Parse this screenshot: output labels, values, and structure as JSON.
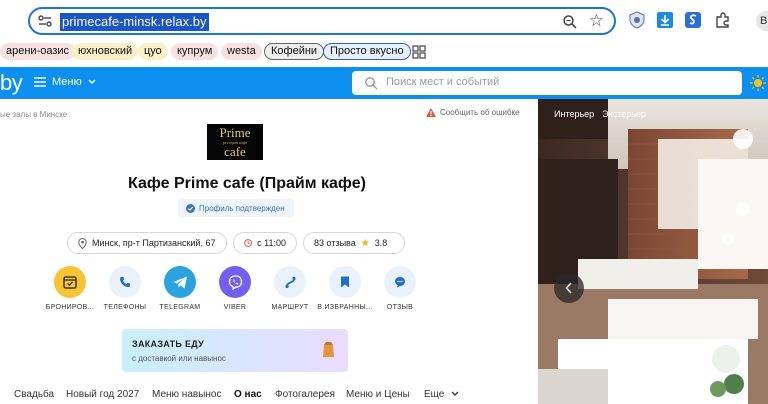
{
  "browser": {
    "url": "primecafe-minsk.relax.by",
    "avatar_letter": "B"
  },
  "bookmarks": [
    {
      "label": "арени-оазис",
      "style": "pink"
    },
    {
      "label": "юхновский",
      "style": "yellow"
    },
    {
      "label": "цуо",
      "style": "yellow"
    },
    {
      "label": "купрум",
      "style": "pink"
    },
    {
      "label": "westa",
      "style": "pink"
    },
    {
      "label": "Кофейни",
      "style": "gray"
    },
    {
      "label": "Просто вкусно",
      "style": "blue"
    }
  ],
  "site": {
    "logo": "by",
    "menu_label": "Меню",
    "search_placeholder": "Поиск мест и событий"
  },
  "page": {
    "breadcrumb": "ые залы в Минске",
    "report_label": "Сообщить об ошибке",
    "logo_line1": "Prime",
    "logo_line2": "ресторан кафе",
    "logo_line3": "cafe",
    "title": "Кафе Prime cafe (Прайм кафе)",
    "verified": "Профиль подтвержден",
    "address": "Минск, пр-т Партизанский, 67",
    "hours": "с 11:00",
    "reviews": "83 отзыва",
    "rating": "3.8"
  },
  "actions": [
    {
      "label": "БРОНИРОВ..."
    },
    {
      "label": "ТЕЛЕФОНЫ"
    },
    {
      "label": "TELEGRAM"
    },
    {
      "label": "VIBER"
    },
    {
      "label": "МАРШРУТ"
    },
    {
      "label": "В ИЗБРАННЫ..."
    },
    {
      "label": "ОТЗЫВ"
    }
  ],
  "food_banner": {
    "heading": "ЗАКАЗАТЬ ЕДУ",
    "subtitle": "с доставкой или навынос"
  },
  "tabs": [
    {
      "label": "Свадьба"
    },
    {
      "label": "Новый год 2027"
    },
    {
      "label": "Меню навынос"
    },
    {
      "label": "О нас"
    },
    {
      "label": "Фотогалерея"
    },
    {
      "label": "Меню и Цены"
    },
    {
      "label": "Еще"
    }
  ],
  "photo": {
    "tab_interior": "Интерьер",
    "tab_exterior": "Экстерьер"
  },
  "colors": {
    "header_blue": "#0d8ff0",
    "accent_yellow": "#f7c533",
    "telegram": "#2aa3df",
    "viber": "#7360f2"
  }
}
